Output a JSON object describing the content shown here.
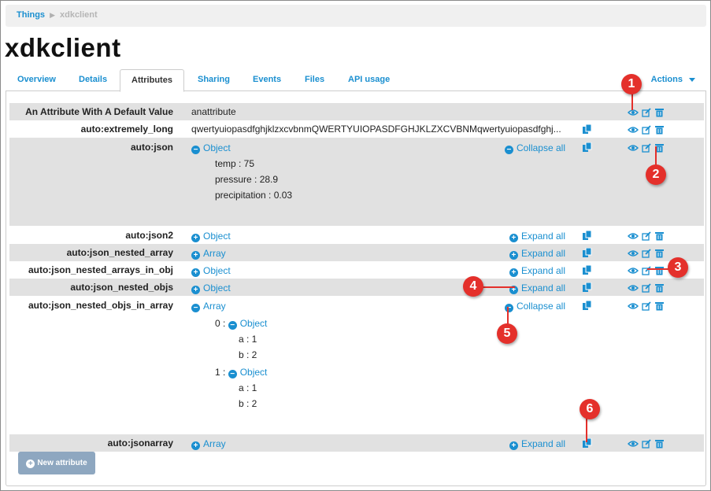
{
  "breadcrumb": {
    "root": "Things",
    "current": "xdkclient"
  },
  "page_title": "xdkclient",
  "tabs": [
    {
      "label": "Overview"
    },
    {
      "label": "Details"
    },
    {
      "label": "Attributes"
    },
    {
      "label": "Sharing"
    },
    {
      "label": "Events"
    },
    {
      "label": "Files"
    },
    {
      "label": "API usage"
    }
  ],
  "actions_label": "Actions",
  "controls": {
    "object": "Object",
    "array": "Array",
    "expand_all": "Expand all",
    "collapse_all": "Collapse all"
  },
  "attributes": [
    {
      "name": "An Attribute With A Default Value",
      "value": "anattribute"
    },
    {
      "name": "auto:extremely_long",
      "value": "qwertyuiopasdfghjklzxcvbnmQWERTYUIOPASDFGHJKLZXCVBNMqwertyuiopasdfghj..."
    },
    {
      "name": "auto:json",
      "fields": [
        "temp : 75",
        "pressure : 28.9",
        "precipitation : 0.03"
      ]
    },
    {
      "name": "auto:json2"
    },
    {
      "name": "auto:json_nested_array"
    },
    {
      "name": "auto:json_nested_arrays_in_obj"
    },
    {
      "name": "auto:json_nested_objs"
    },
    {
      "name": "auto:json_nested_objs_in_array",
      "items": [
        {
          "index": "0 :",
          "fields": [
            "a : 1",
            "b : 2"
          ]
        },
        {
          "index": "1 :",
          "fields": [
            "a : 1",
            "b : 2"
          ]
        }
      ]
    },
    {
      "name": "auto:jsonarray"
    }
  ],
  "new_attribute_label": "New attribute",
  "callouts": [
    "1",
    "2",
    "3",
    "4",
    "5",
    "6"
  ],
  "colors": {
    "link": "#1a8fd0",
    "row_shade": "#e1e1e1",
    "callout": "#e4302b",
    "button": "#8ea7c0"
  },
  "icons": [
    "eye-icon",
    "edit-icon",
    "trash-icon",
    "copy-icon",
    "plus-circle-icon",
    "minus-circle-icon",
    "caret-down-icon"
  ]
}
